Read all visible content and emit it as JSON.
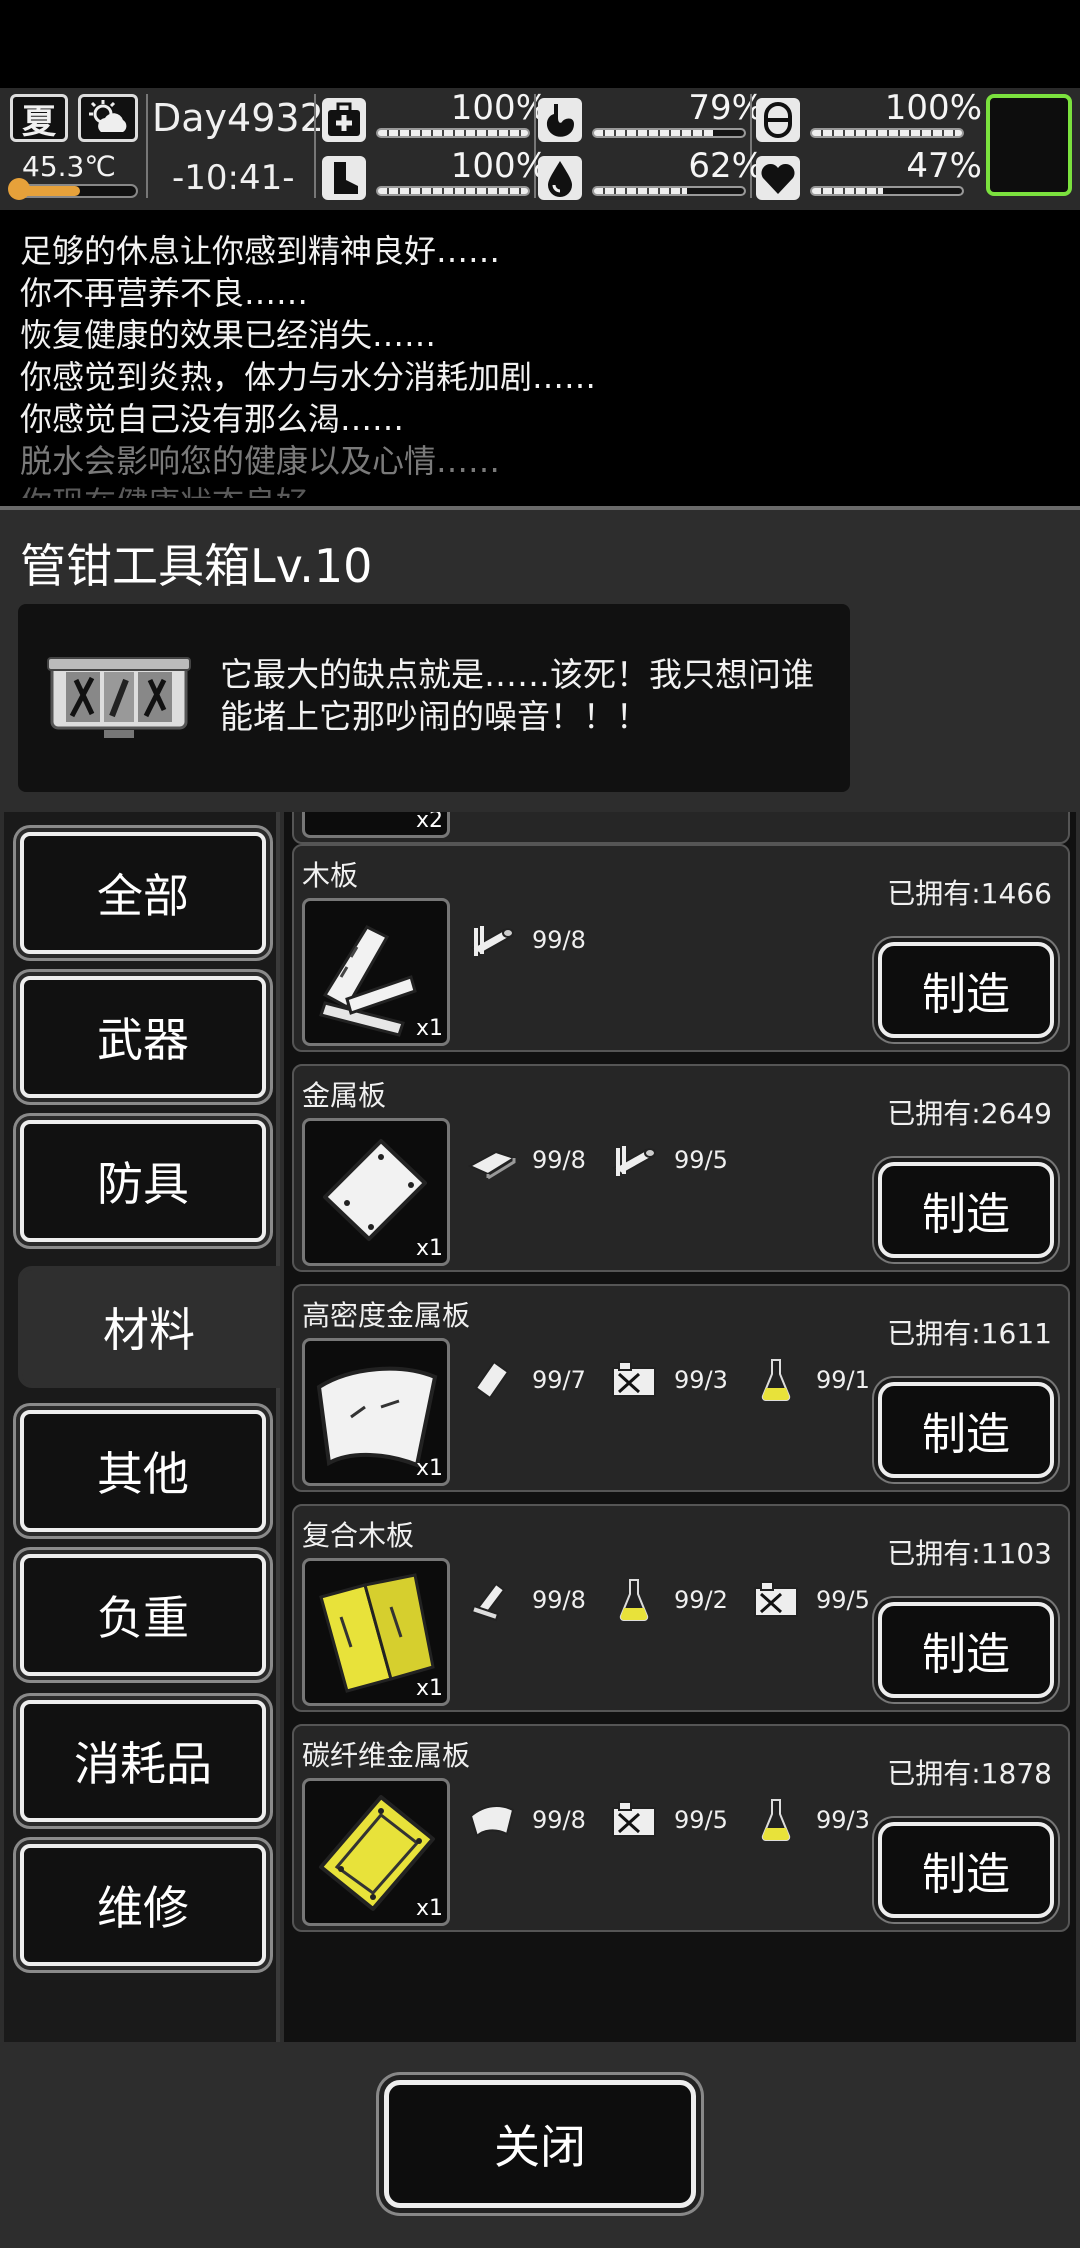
{
  "hud": {
    "season": "夏",
    "temperature": "45.3℃",
    "temperature_level": 0.55,
    "day": "Day4932",
    "time": "-10:41-",
    "stats": [
      {
        "name": "health",
        "icon": "medkit-icon",
        "value": "100%",
        "level": 1.0
      },
      {
        "name": "hunger",
        "icon": "stomach-icon",
        "value": "79%",
        "level": 0.79
      },
      {
        "name": "pill",
        "icon": "pill-icon",
        "value": "100%",
        "level": 1.0
      },
      {
        "name": "stamina",
        "icon": "boot-icon",
        "value": "100%",
        "level": 1.0
      },
      {
        "name": "thirst",
        "icon": "water-drop-icon",
        "value": "62%",
        "level": 0.62
      },
      {
        "name": "mood",
        "icon": "heart-icon",
        "value": "47%",
        "level": 0.47
      }
    ]
  },
  "log": [
    "足够的休息让你感到精神良好……",
    "你不再营养不良……",
    "恢复健康的效果已经消失……",
    "你感觉到炎热，体力与水分消耗加剧……",
    "你感觉自己没有那么渴……",
    "脱水会影响您的健康以及心情……",
    "你现在健康状态良好"
  ],
  "panel": {
    "title": "管钳工具箱Lv.10",
    "description": "它最大的缺点就是……该死！我只想问谁能堵上它那吵闹的噪音！！！"
  },
  "categories": [
    "全部",
    "武器",
    "防具",
    "材料",
    "其他",
    "负重",
    "消耗品",
    "维修"
  ],
  "active_category": "材料",
  "partial_qty": "x2",
  "recipes": [
    {
      "name": "木板",
      "owned": "已拥有:1466",
      "qty": "x1",
      "make": "制造",
      "ingredients": [
        {
          "icon": "log-icon",
          "amount": "99/8"
        }
      ]
    },
    {
      "name": "金属板",
      "owned": "已拥有:2649",
      "qty": "x1",
      "make": "制造",
      "ingredients": [
        {
          "icon": "metal-bar-icon",
          "amount": "99/8"
        },
        {
          "icon": "log-icon",
          "amount": "99/5"
        }
      ]
    },
    {
      "name": "高密度金属板",
      "owned": "已拥有:1611",
      "qty": "x1",
      "make": "制造",
      "ingredients": [
        {
          "icon": "metal-sheet-icon",
          "amount": "99/7"
        },
        {
          "icon": "fuel-can-icon",
          "amount": "99/3"
        },
        {
          "icon": "flask-icon",
          "amount": "99/1"
        }
      ]
    },
    {
      "name": "复合木板",
      "owned": "已拥有:1103",
      "qty": "x1",
      "make": "制造",
      "ingredients": [
        {
          "icon": "plank-icon",
          "amount": "99/8"
        },
        {
          "icon": "flask-icon",
          "amount": "99/2"
        },
        {
          "icon": "fuel-can-icon",
          "amount": "99/5"
        }
      ]
    },
    {
      "name": "碳纤维金属板",
      "owned": "已拥有:1878",
      "qty": "x1",
      "make": "制造",
      "ingredients": [
        {
          "icon": "dense-metal-sheet-icon",
          "amount": "99/8"
        },
        {
          "icon": "fuel-can-icon",
          "amount": "99/5"
        },
        {
          "icon": "flask-icon",
          "amount": "99/3"
        }
      ]
    }
  ],
  "close_label": "关闭",
  "colors": {
    "accent_green": "#7be13e",
    "temp_orange": "#e6a13a",
    "flask_yellow": "#e8e23a"
  }
}
